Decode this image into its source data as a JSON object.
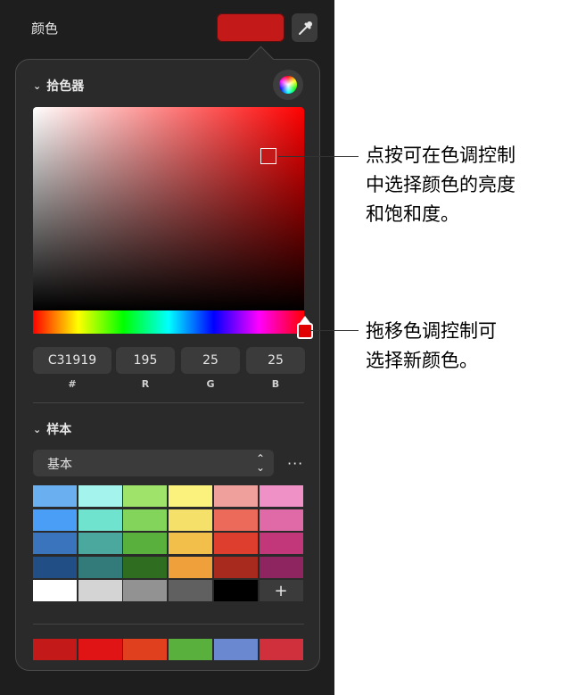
{
  "header": {
    "label": "颜色",
    "current_color": "#c31919"
  },
  "picker": {
    "title": "拾色器",
    "hex": "C31919",
    "r": "195",
    "g": "25",
    "b": "25",
    "labels": {
      "hex": "#",
      "r": "R",
      "g": "G",
      "b": "B"
    }
  },
  "swatches": {
    "title": "样本",
    "palette": "基本",
    "more": "···",
    "add": "+",
    "grid": [
      [
        "#6ab0f0",
        "#a4f3ec",
        "#9fe36b",
        "#fbf27e",
        "#f0a09c",
        "#ef91c7"
      ],
      [
        "#4a9ef5",
        "#70e3cf",
        "#82d45a",
        "#f5e06a",
        "#ec6a5a",
        "#e06aa8"
      ],
      [
        "#3a74bd",
        "#4aa89e",
        "#5ab03c",
        "#f2c04a",
        "#de3e2e",
        "#c2367a"
      ],
      [
        "#224e86",
        "#337a7a",
        "#2f6e21",
        "#f0a03a",
        "#a82a1e",
        "#8e2460"
      ],
      [
        "#ffffff",
        "#d4d4d4",
        "#929292",
        "#606060",
        "#000000",
        "add"
      ]
    ],
    "recent": [
      "#c31919",
      "#e01414",
      "#e0401e",
      "#5ab03c",
      "#6a88d0",
      "#d0303c"
    ]
  },
  "callouts": {
    "c1": [
      "点按可在色调控制",
      "中选择颜色的亮度",
      "和饱和度。"
    ],
    "c2": [
      "拖移色调控制可",
      "选择新颜色。"
    ]
  }
}
